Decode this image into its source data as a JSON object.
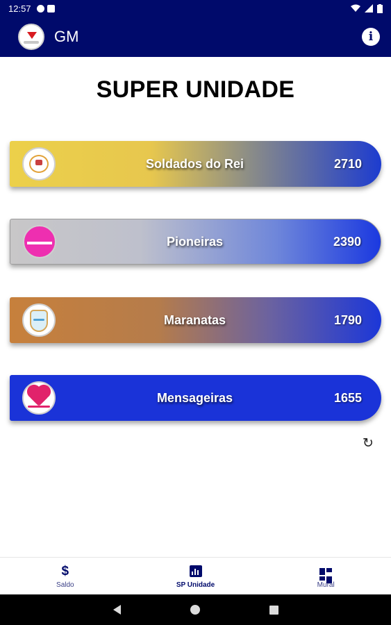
{
  "status_bar": {
    "time": "12:57"
  },
  "app_bar": {
    "title": "GM",
    "info_icon": "info-icon",
    "logo_icon": "gm-logo-icon"
  },
  "page": {
    "title": "SUPER UNIDADE"
  },
  "units": [
    {
      "name": "Soldados do Rei",
      "score": "2710",
      "logo": "soldados-do-rei-logo"
    },
    {
      "name": "Pioneiras",
      "score": "2390",
      "logo": "pioneiras-logo"
    },
    {
      "name": "Maranatas",
      "score": "1790",
      "logo": "maranatas-logo"
    },
    {
      "name": "Mensageiras",
      "score": "1655",
      "logo": "mensageiras-logo"
    }
  ],
  "refresh_icon": "refresh-icon",
  "bottom_nav": {
    "items": [
      {
        "label": "Saldo",
        "icon": "dollar-icon",
        "active": false
      },
      {
        "label": "SP Unidade",
        "icon": "bar-chart-icon",
        "active": true
      },
      {
        "label": "Mural",
        "icon": "dashboard-icon",
        "active": false
      }
    ]
  },
  "colors": {
    "primary": "#000a6b",
    "card_blue": "#1a33d8",
    "soldados_gold": "#ecd04a",
    "pioneiras_gray": "#c8c7c8",
    "maranatas_bronze": "#c7803c"
  }
}
